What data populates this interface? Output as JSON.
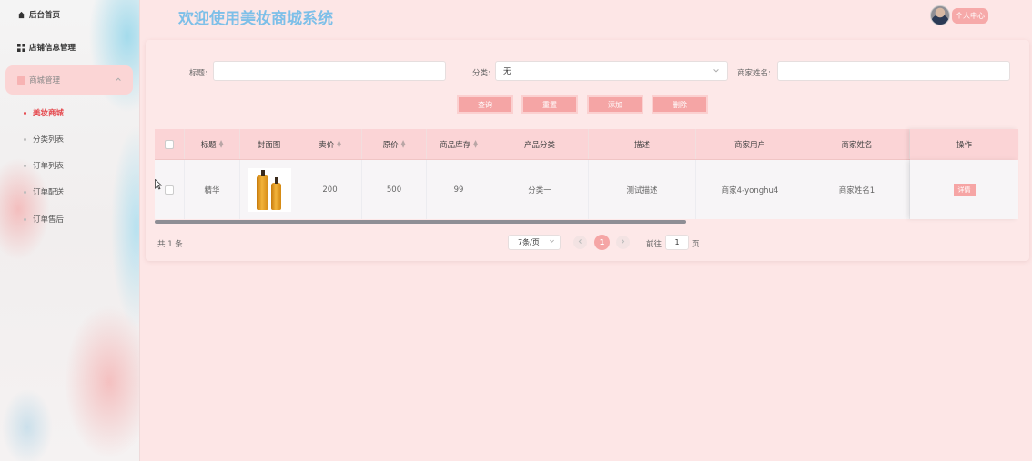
{
  "header": {
    "title": "欢迎使用美妆商城系统",
    "profile_label": "个人中心"
  },
  "sidebar": {
    "items": [
      {
        "label": "后台首页",
        "icon": "home-icon"
      },
      {
        "label": "店铺信息管理",
        "icon": "grid-icon"
      },
      {
        "label": "商城管理",
        "icon": "menu-icon"
      }
    ],
    "subitems": [
      {
        "label": "美妆商城",
        "active": true
      },
      {
        "label": "分类列表",
        "active": false
      },
      {
        "label": "订单列表",
        "active": false
      },
      {
        "label": "订单配送",
        "active": false
      },
      {
        "label": "订单售后",
        "active": false
      }
    ]
  },
  "filters": {
    "title_label": "标题:",
    "title_value": "",
    "category_label": "分类:",
    "category_value": "无",
    "merchant_label": "商家姓名:",
    "merchant_value": ""
  },
  "actions": {
    "query": "查询",
    "reset": "重置",
    "add": "添加",
    "delete": "删除"
  },
  "table": {
    "columns": [
      "标题",
      "封面图",
      "卖价",
      "原价",
      "商品库存",
      "产品分类",
      "描述",
      "商家用户",
      "商家姓名",
      "操作"
    ],
    "rows": [
      {
        "title": "精华",
        "price": "200",
        "original_price": "500",
        "stock": "99",
        "category": "分类一",
        "description": "测试描述",
        "merchant_user": "商家4-yonghu4",
        "merchant_name": "商家姓名1",
        "action": "详情"
      }
    ]
  },
  "pagination": {
    "total": "共 1 条",
    "page_size": "7条/页",
    "current_page": "1",
    "goto_prefix": "前往",
    "goto_value": "1",
    "goto_suffix": "页"
  },
  "colors": {
    "accent": "#f5a5a5",
    "title": "#7dbfe8",
    "active_menu": "#e5484d",
    "background": "#fde6e6"
  }
}
